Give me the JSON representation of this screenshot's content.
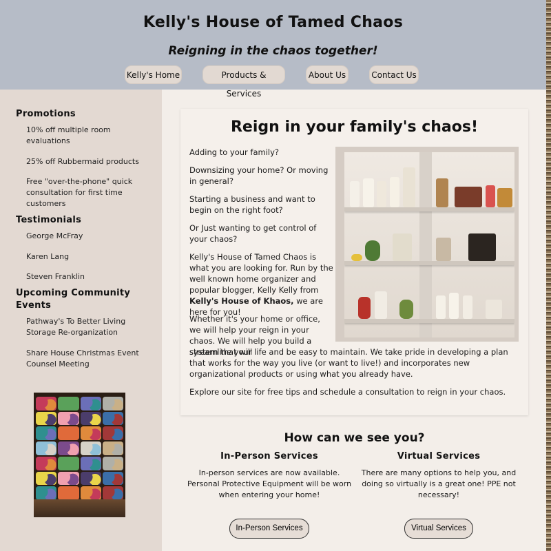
{
  "header": {
    "title": "Kelly's House of Tamed Chaos",
    "tagline": "Reigning in the chaos together!"
  },
  "nav": [
    {
      "label": "Kelly's Home"
    },
    {
      "label": "Products & Services"
    },
    {
      "label": "About Us"
    },
    {
      "label": "Contact Us"
    }
  ],
  "sidebar": {
    "promotions_heading": "Promotions",
    "promotions": [
      "10% off multiple room evaluations",
      "25% off Rubbermaid products",
      "Free \"over-the-phone\" quick consultation for first time customers"
    ],
    "testimonials_heading": "Testimonials",
    "testimonials": [
      "George McFray",
      "Karen Lang",
      "Steven Franklin"
    ],
    "events_heading": "Upcoming Community Events",
    "events": [
      "Pathway's To Better Living Storage Re-organization",
      "Share House Christmas Event Counsel Meeting"
    ]
  },
  "main": {
    "title": "Reign in your family's chaos!",
    "p1": "Adding to your family?",
    "p2": "Downsizing your home? Or moving in general?",
    "p3": "Starting a business and want to begin on the right foot?",
    "p4": "Or Just wanting to get control of your chaos?",
    "p5_start": "Kelly's House of Tamed Chaos is what you are looking for. Run by the well known home organizer and popular blogger, Kelly Kelly from ",
    "p5_bold": "Kelly's House of Khaos,",
    "p5_end": " we are here for you!",
    "p6_a": "Whether it's your home or office, we will help your reign in your chaos. We will help you build a system that will",
    "p6_b": "streamline your life and be easy to maintain. We take pride in developing a plan that works for the way you live (or want to live!) and incorporates new organizational products or using what you already have.",
    "p7": "Explore our site for free tips and schedule a consultation to reign in your chaos."
  },
  "services": {
    "heading": "How can we see you?",
    "in_person": {
      "title": "In-Person Services",
      "text": "In-person services are now available. Personal Protective Equipment will be worn when entering your home!",
      "button": "In-Person Services"
    },
    "virtual": {
      "title": "Virtual Services",
      "text": "There are many options to help you, and doing so virtually is a great one! PPE not necessary!",
      "button": "Virtual Services"
    }
  },
  "colors": {
    "header_bg": "#b6bcc7",
    "sidebar_bg": "#e3d9d2",
    "page_bg": "#f3eee9",
    "button_bg": "#e2d9d2"
  },
  "images": {
    "pantry_icon": "pantry-shelves-photo",
    "yarn_icon": "yarn-cubby-photo"
  }
}
